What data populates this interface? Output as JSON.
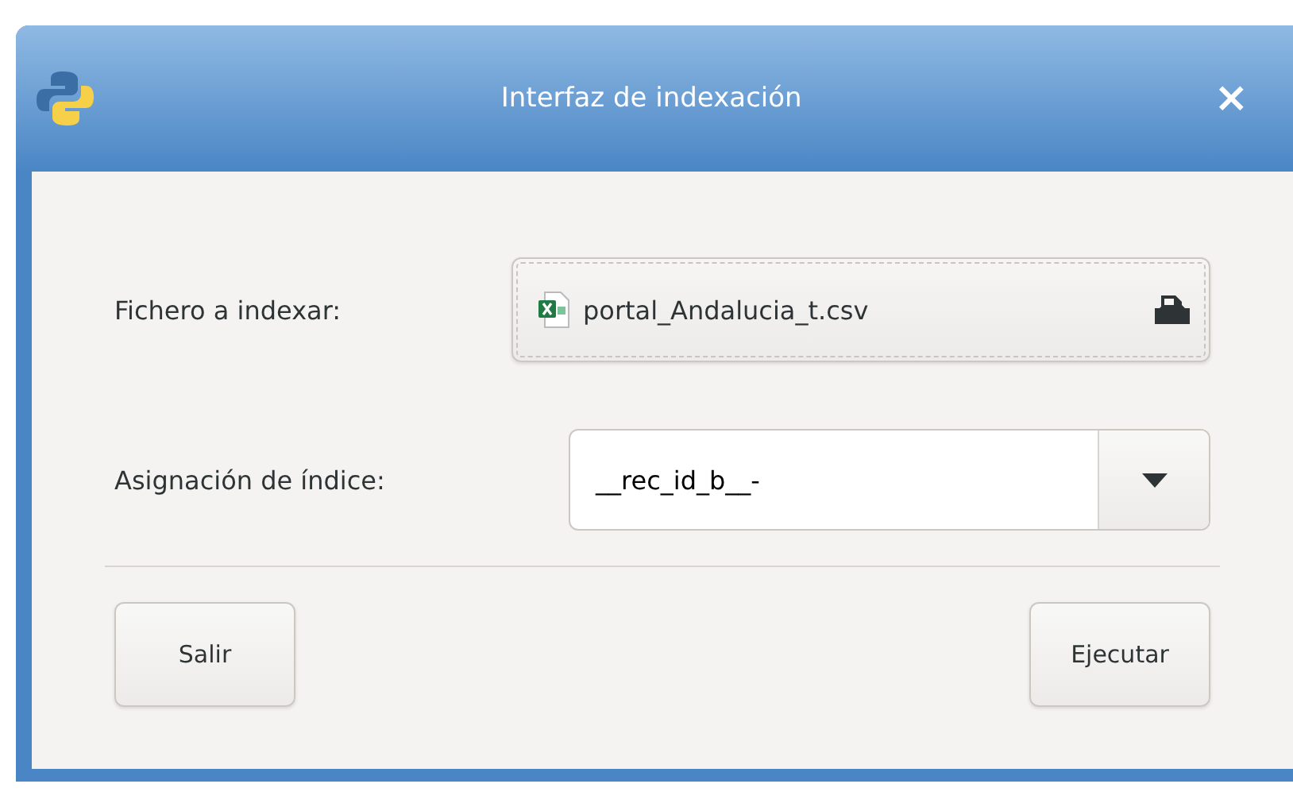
{
  "window": {
    "title": "Interfaz de indexación",
    "close": "×"
  },
  "file_field": {
    "label": "Fichero a indexar:",
    "value": "portal_Andalucia_t.csv"
  },
  "index_field": {
    "label": "Asignación de índice:",
    "value": "__rec_id_b__-"
  },
  "buttons": [
    {
      "label": "Salir"
    },
    {
      "label": "Ejecutar"
    }
  ]
}
